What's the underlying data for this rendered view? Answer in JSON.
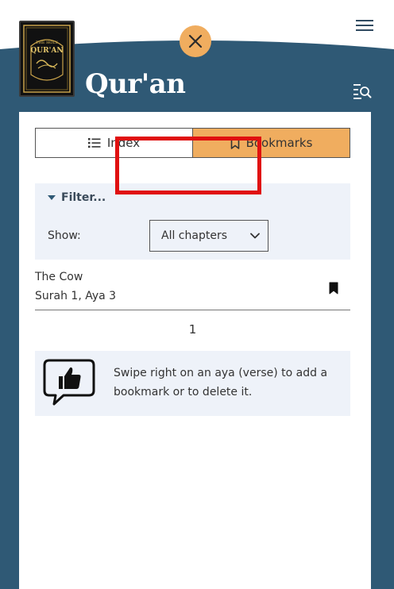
{
  "header": {
    "title": "Qur'an",
    "book_cover_alt": "THE HOLY QUR'AN",
    "colors": {
      "banner": "#2f5975",
      "accent": "#f0ad5f"
    },
    "icons": {
      "close": "close-icon",
      "menu": "hamburger-menu-icon",
      "search": "list-search-icon"
    }
  },
  "tabs": {
    "index_label": "Index",
    "bookmarks_label": "Bookmarks",
    "active": "Bookmarks"
  },
  "filter": {
    "toggle_label": "Filter...",
    "show_label": "Show:",
    "select_value": "All chapters"
  },
  "bookmarks": [
    {
      "chapter": "The Cow",
      "reference": "Surah 1, Aya 3"
    }
  ],
  "pagination": {
    "current_page": "1"
  },
  "hint": {
    "text": "Swipe right on an aya (verse) to add a bookmark or to delete it."
  }
}
